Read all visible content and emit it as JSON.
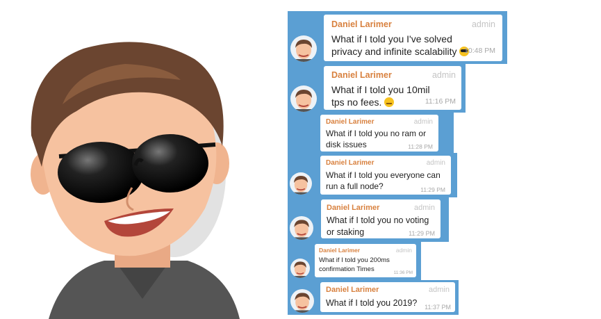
{
  "chat": {
    "messages": [
      {
        "sender": "Daniel Larimer",
        "role": "admin",
        "text": "What if I told you I've solved privacy and infinite scalability",
        "emoji": "sunglasses-emoji",
        "time": "10:48 PM"
      },
      {
        "sender": "Daniel Larimer",
        "role": "admin",
        "text": "What if I told you 10mil tps no fees.",
        "emoji": "smirk-emoji",
        "time": "11:16 PM"
      },
      {
        "sender": "Daniel Larimer",
        "role": "admin",
        "text": "What if I told you no ram or disk issues",
        "time": "11:28 PM"
      },
      {
        "sender": "Daniel Larimer",
        "role": "admin",
        "text": "What if I told you everyone can run a full node?",
        "time": "11:29 PM"
      },
      {
        "sender": "Daniel Larimer",
        "role": "admin",
        "text": "What if I told you no voting or staking",
        "time": "11:29 PM"
      },
      {
        "sender": "Daniel Larimer",
        "role": "admin",
        "text": "What if I told you 200ms confirmation Times",
        "time": "11:36 PM"
      },
      {
        "sender": "Daniel Larimer",
        "role": "admin",
        "text": "What if I told you 2019?",
        "time": "11:37 PM"
      }
    ]
  },
  "colors": {
    "chat_background": "#5b9fd3",
    "sender_name": "#d8813f",
    "bubble": "#ffffff"
  },
  "icons": {
    "avatar": "cartoon-avatar-icon",
    "emoji": "emoji-icon"
  }
}
